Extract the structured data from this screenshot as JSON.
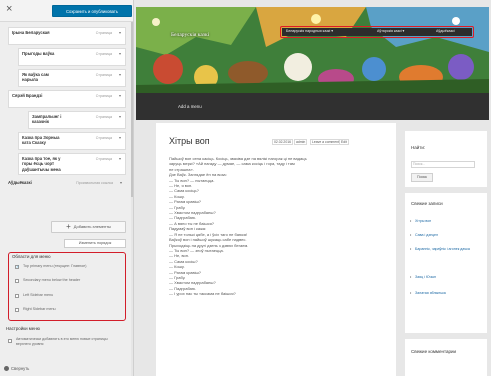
{
  "customizer": {
    "close_label": "×",
    "save_label": "Сохранить и опубликовать",
    "menu_items": [
      {
        "title": "Ірына Беларуская",
        "type": "Страница",
        "level": 0
      },
      {
        "title": "Прыгоды ваўка",
        "type": "Страница",
        "level": 1
      },
      {
        "title": "Як ваўка сам нарыла",
        "type": "Страница",
        "level": 1
      },
      {
        "title": "Сярэй Брандзі",
        "type": "Страница",
        "level": 0
      },
      {
        "title": "Зампральчнг і казачнік",
        "type": "Страница",
        "level": 1
      },
      {
        "title": "Казка пра Зорныа ката Сказку",
        "type": "Страница",
        "level": 0
      },
      {
        "title": "Казка пра тое, як у горы ёсць чорт даўшантычы мена",
        "type": "Страница",
        "level": 0
      },
      {
        "title": "Аўдыёказкі",
        "type": "Произвольная ссылка",
        "level": 0
      }
    ],
    "add_items_label": "Добавить элементы",
    "reorder_label": "Изменить порядок",
    "locations": {
      "title": "Области для меню",
      "options": [
        {
          "label": "Top primary menu (текущее: Главное)",
          "checked": true
        },
        {
          "label": "Secondary menu below the header",
          "checked": false
        },
        {
          "label": "Left Sidebar menu",
          "checked": false
        },
        {
          "label": "Right Sidebar menu",
          "checked": false
        }
      ]
    },
    "settings": {
      "title": "Настройки меню",
      "auto_add_label": "Автоматически добавлять в это меню новые страницы верхнего уровня"
    },
    "collapse_label": "Свернуть"
  },
  "preview": {
    "site_title": "Беларускія казкі",
    "nav_items": [
      "Беларускія народныя казкі ▾",
      "Аўтарскія казкі ▾",
      "Аўдыёказкі"
    ],
    "add_menu_label": "Add a menu",
    "post": {
      "title": "Хітры воп",
      "date": "02.02.2016",
      "author": "admin",
      "comment_link": "Leave a comment",
      "edit_link": "Edit",
      "body": "Пайшоў воп сена касіць. Косіць, звазіва дзе на вялікі пагорак ці не вадаць\nзаруць меркі? «Ай пагаду — думае, — сама косіць і гора, таду і там\nне страшна».\nДзе Ваўк. Заглядае ён на воза:\n— Ты воп? — пытаецца.\n— Не, я воп.\n— Сама косіць?\n— Кошу.\n— Рагам кравіш?\n— Грабу.\n— Хвастом падграбаеш?\n— Падграбаю.\n— А вяно ты не баішся?\nПадумаў воп і кажа:\n— Я не толькі цябе, а і ўсіх таго не баюся!\nВаўкоў воп і пайшоў шукаць сабе падвес.\nПрыходзіць на другі дзень з дзвюх бегаем.\n— Ты воп? — зноў пытаецца.\n— Не, воп.\n— Сама косіш?\n— Кошу.\n— Рагам кравіш?\n— Грабу.\n— Хвастом падграбаеш?\n— Падграбаю.\n— І урох нас ты таксама не баішся?"
    },
    "sidebar": {
      "search_title": "Найти:",
      "search_placeholder": "Поиск...",
      "search_button": "Поиск",
      "recent_posts_title": "Свежие записи",
      "recent_posts": [
        "Хітры воп",
        "Сава і дзецел",
        "Бараннік, чараўнік і агонек дачка",
        "Заяц і Ючын",
        "Залатая яблынька"
      ],
      "recent_comments_title": "Свежие комментарии"
    }
  }
}
